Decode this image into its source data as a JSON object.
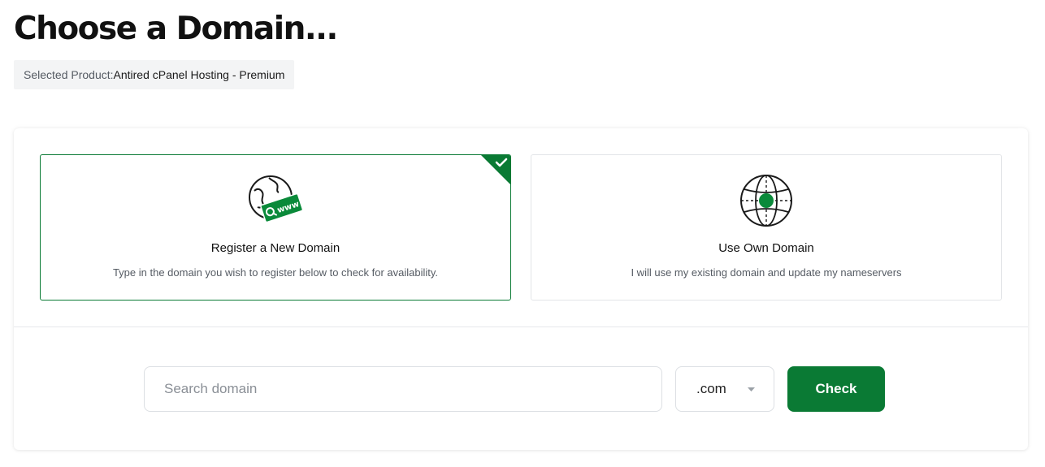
{
  "page": {
    "title": "Choose a Domain...",
    "selected_product_label": "Selected Product:",
    "selected_product_value": "Antired cPanel Hosting - Premium"
  },
  "options": [
    {
      "title": "Register a New Domain",
      "description": "Type in the domain you wish to register below to check for availability.",
      "icon": "globe-www-icon",
      "selected": true
    },
    {
      "title": "Use Own Domain",
      "description": "I will use my existing domain and update my nameservers",
      "icon": "globe-location-icon",
      "selected": false
    }
  ],
  "search": {
    "placeholder": "Search domain",
    "value": "",
    "tld": ".com",
    "button_label": "Check"
  },
  "colors": {
    "accent": "#0a7a34",
    "border": "#e3e5e8",
    "muted_text": "#555b63"
  }
}
